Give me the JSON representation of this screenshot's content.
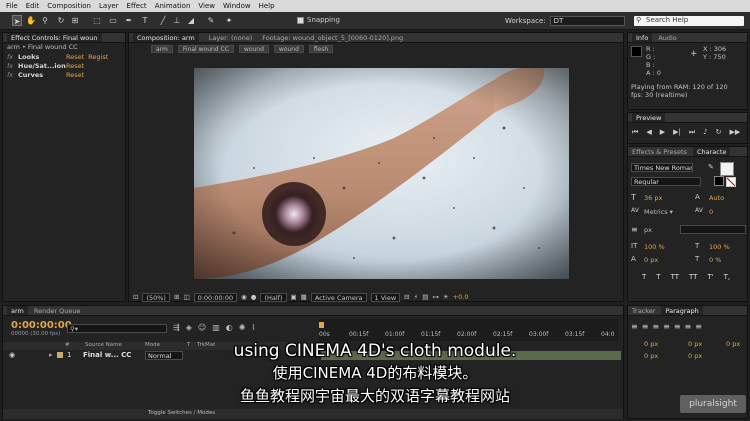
{
  "menu": [
    "File",
    "Edit",
    "Composition",
    "Layer",
    "Effect",
    "Animation",
    "View",
    "Window",
    "Help"
  ],
  "toolbar": {
    "snapping": "Snapping",
    "workspace_label": "Workspace:",
    "workspace_value": "DT",
    "search_placeholder": "Search Help"
  },
  "effect_controls": {
    "tab": "Effect Controls: Final woun",
    "layer_path": "arm • Final wound CC",
    "effects": [
      {
        "name": "Looks",
        "reset": "Reset",
        "extra": "Regist"
      },
      {
        "name": "Hue/Sat...ion",
        "reset": "Reset",
        "extra": ""
      },
      {
        "name": "Curves",
        "reset": "Reset",
        "extra": ""
      }
    ]
  },
  "viewer": {
    "tabs": [
      "Composition: arm",
      "Layer: (none)",
      "Footage: wound_object_5_[0060-0120].png"
    ],
    "breadcrumbs": [
      "arm",
      "Final wound CC",
      "wound",
      "wound",
      "flesh"
    ],
    "zoom": "(50%)",
    "timecode": "0:00:00:00",
    "resolution": "(Half)",
    "camera": "Active Camera",
    "views": "1 View",
    "exposure": "+0.0"
  },
  "info": {
    "tabs": [
      "Info",
      "Audio"
    ],
    "rgba": [
      "R :",
      "G :",
      "B :",
      "A : 0"
    ],
    "x": "X : 306",
    "y": "Y : 750",
    "line1": "Playing from RAM: 120 of 120",
    "line2": "fps: 30 (realtime)"
  },
  "preview": {
    "tab": "Preview"
  },
  "character": {
    "tabs": [
      "Effects & Presets",
      "Characte"
    ],
    "font": "Times New Roman",
    "style": "Regular",
    "size": "36 px",
    "leading": "Auto",
    "tracking": "0",
    "px_unit": "px",
    "vscale": "100 %",
    "hscale": "100 %",
    "baseline": "0 px",
    "tsume": "0 %",
    "styles": [
      "T",
      "T",
      "TT",
      "TT",
      "T'",
      "T,"
    ]
  },
  "timeline": {
    "tabs": [
      "arm",
      "Render Queue"
    ],
    "timecode": "0:00:00:00",
    "frame_info": "00000 (30.00 fps)",
    "search_glyph": "⚲▾",
    "ruler": [
      "00s",
      "00:15f",
      "01:00f",
      "01:15f",
      "02:00f",
      "02:15f",
      "03:00f",
      "03:15f",
      "04:0"
    ],
    "headers": [
      "#",
      "Source Name",
      "Mode",
      "T",
      "TrkMat"
    ],
    "layer": {
      "index": "1",
      "name": "Final w... CC",
      "mode": "Normal"
    },
    "toggle": "Toggle Switches / Modes"
  },
  "tracker": {
    "tabs": [
      "Tracker",
      "Paragraph"
    ],
    "values": [
      "0 px",
      "0 px",
      "0 px",
      "0 px",
      "0 px"
    ]
  },
  "subtitles": {
    "english": "using CINEMA 4D's cloth module.",
    "chinese": "使用CINEMA 4D的布料模块。",
    "watermark": "鱼鱼教程网宇宙最大的双语字幕教程网站"
  },
  "brand": "pluralsight",
  "colors": {
    "accent": "#e0a64a",
    "panel": "#232323",
    "menu": "#dadada"
  }
}
